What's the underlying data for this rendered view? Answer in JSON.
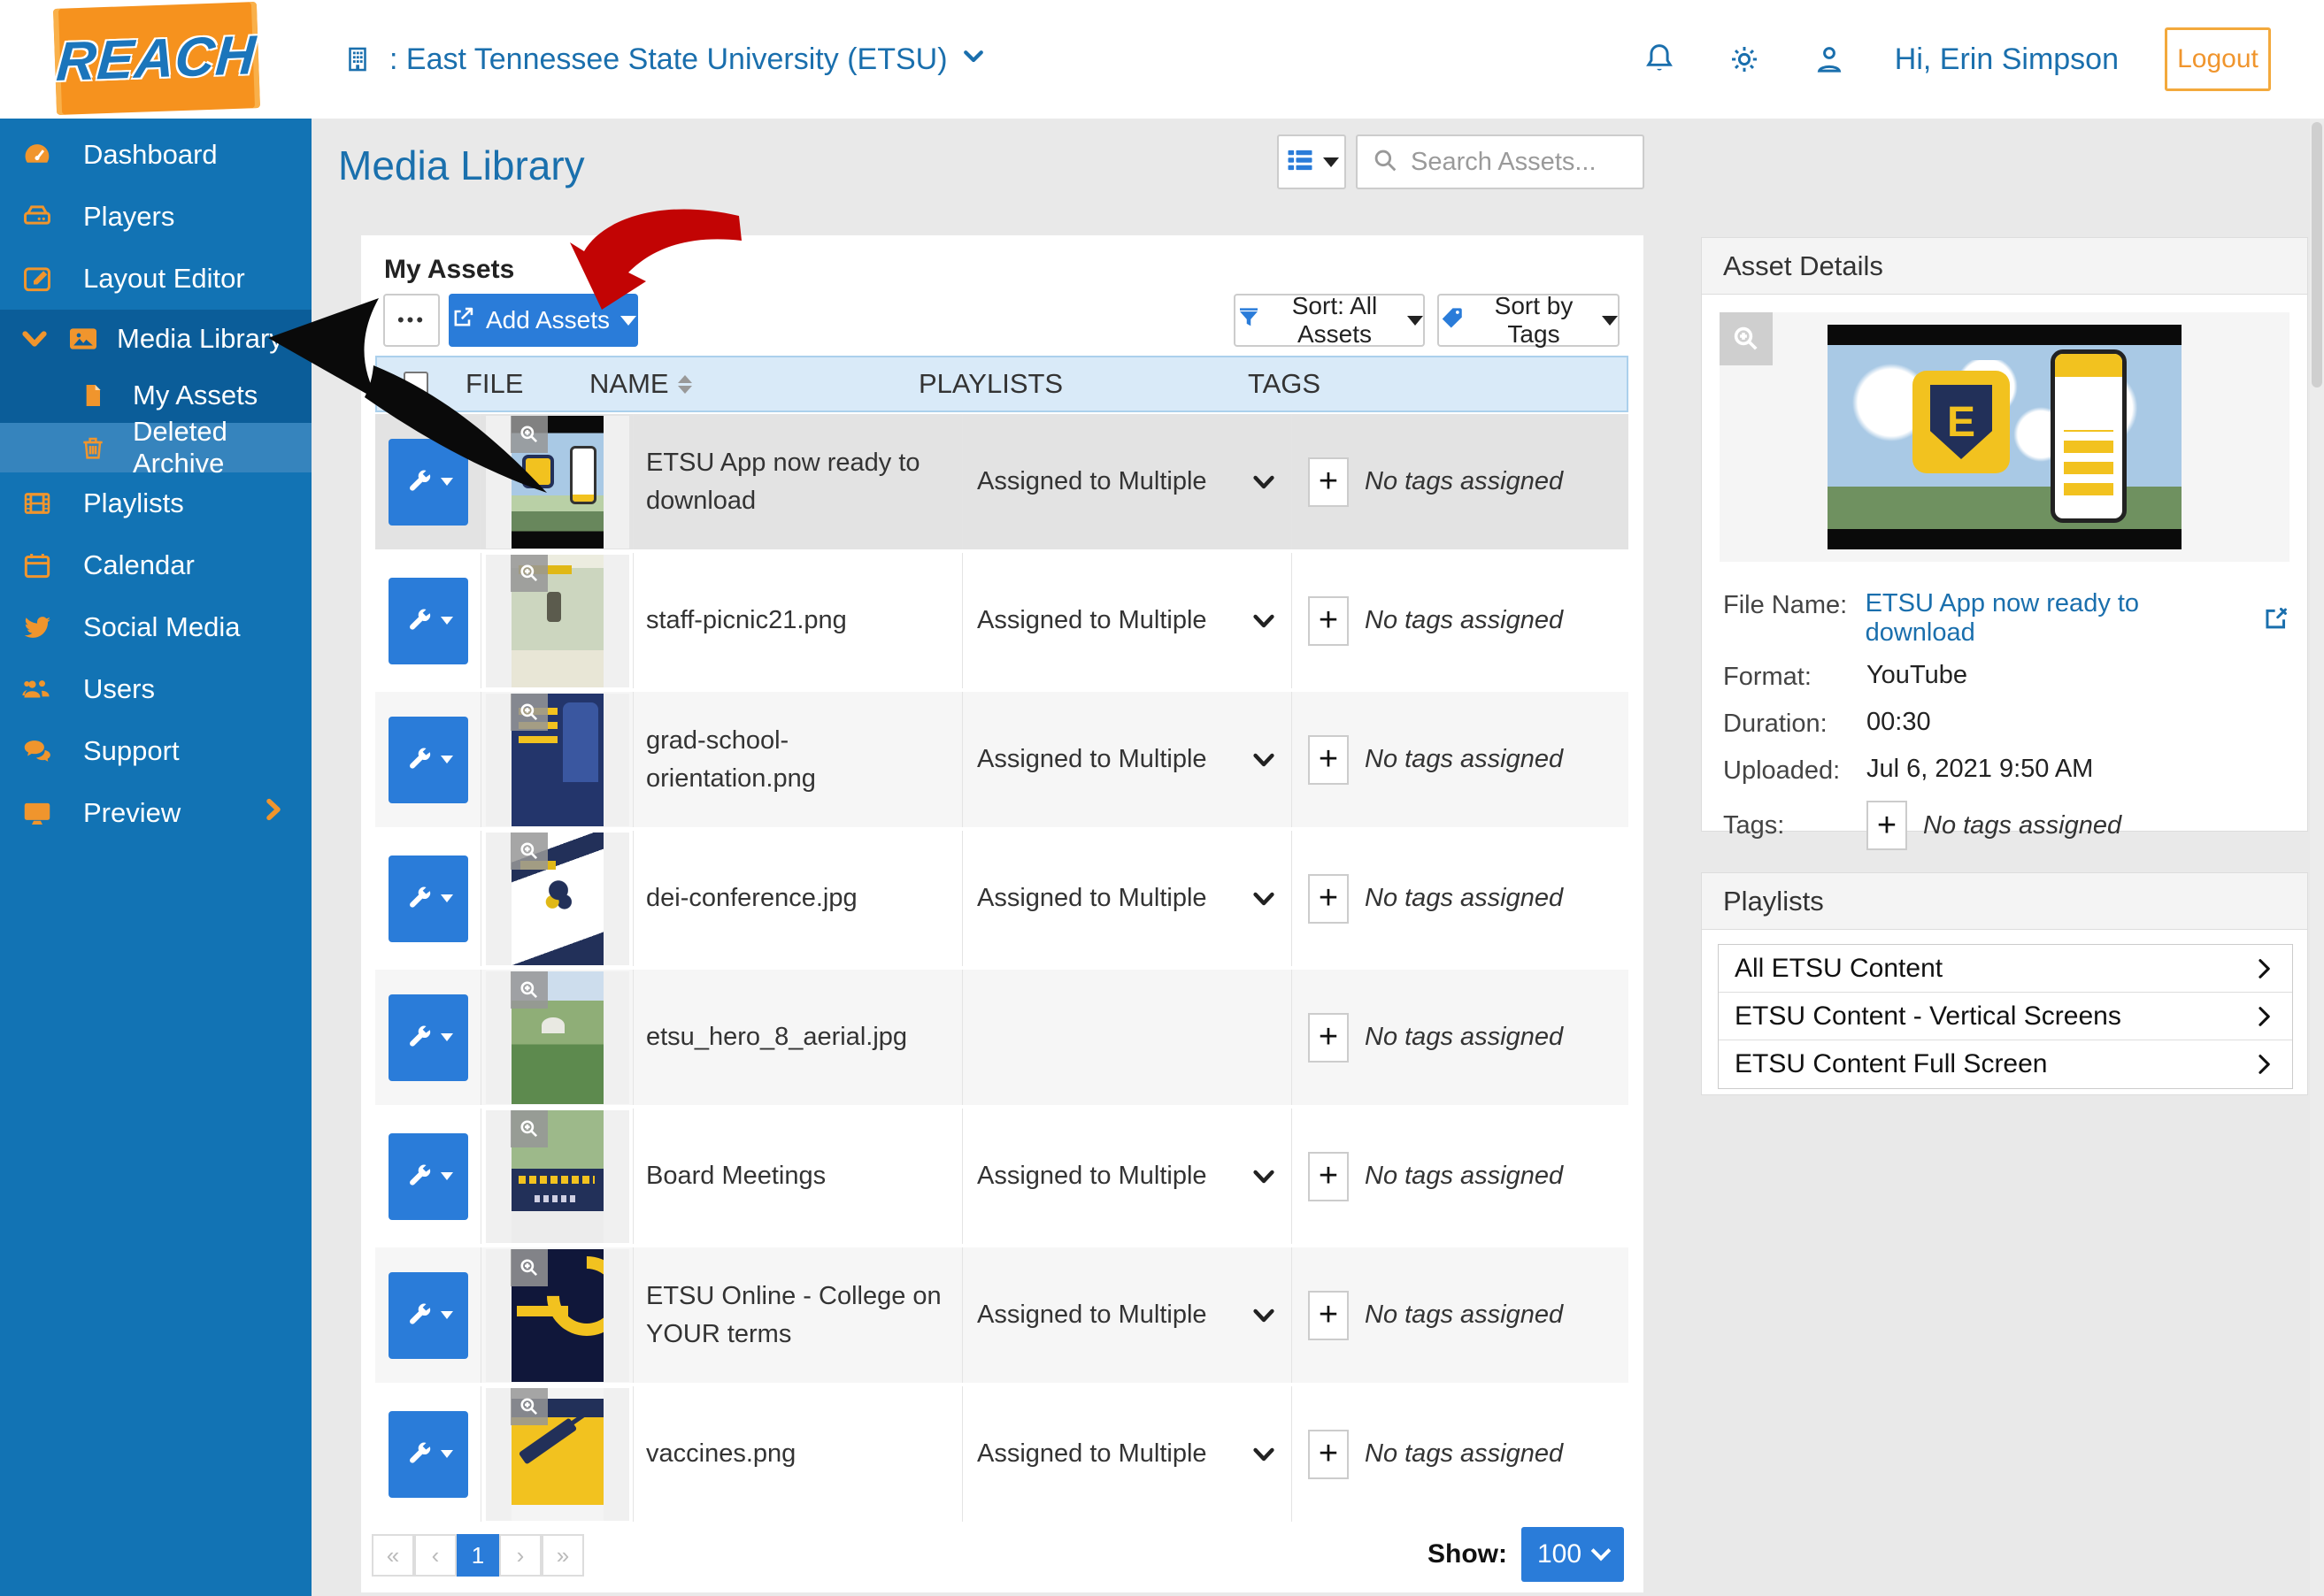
{
  "header": {
    "brand": "REACH",
    "account": ": East Tennessee State University (ETSU)",
    "greeting": "Hi, Erin Simpson",
    "logout_label": "Logout"
  },
  "sidebar": {
    "items": [
      "Dashboard",
      "Players",
      "Layout Editor",
      "Media Library",
      "My Assets",
      "Deleted Archive",
      "Playlists",
      "Calendar",
      "Social Media",
      "Users",
      "Support",
      "Preview"
    ]
  },
  "page": {
    "title": "Media Library",
    "search_placeholder": "Search Assets...",
    "section_title": "My Assets",
    "more_label": "•••",
    "add_assets_label": "Add Assets",
    "sort_assets_label": "Sort: All Assets",
    "sort_tags_label": "Sort by Tags"
  },
  "table": {
    "columns": [
      "FILE",
      "NAME",
      "PLAYLISTS",
      "TAGS"
    ],
    "rows": [
      {
        "name": "ETSU App now ready to download",
        "playlists": "Assigned to Multiple",
        "tags": "No tags assigned"
      },
      {
        "name": "staff-picnic21.png",
        "playlists": "Assigned to Multiple",
        "tags": "No tags assigned"
      },
      {
        "name": "grad-school-orientation.png",
        "playlists": "Assigned to Multiple",
        "tags": "No tags assigned"
      },
      {
        "name": "dei-conference.jpg",
        "playlists": "Assigned to Multiple",
        "tags": "No tags assigned"
      },
      {
        "name": "etsu_hero_8_aerial.jpg",
        "playlists": "",
        "tags": "No tags assigned"
      },
      {
        "name": "Board Meetings",
        "playlists": "Assigned to Multiple",
        "tags": "No tags assigned"
      },
      {
        "name": "ETSU Online - College on YOUR terms",
        "playlists": "Assigned to Multiple",
        "tags": "No tags assigned"
      },
      {
        "name": "vaccines.png",
        "playlists": "Assigned to Multiple",
        "tags": "No tags assigned"
      }
    ]
  },
  "pagination": {
    "first": "«",
    "prev": "‹",
    "page": "1",
    "next": "›",
    "last": "»",
    "show_label": "Show:",
    "page_size": "100"
  },
  "asset_details": {
    "title": "Asset Details",
    "file_name_label": "File Name:",
    "file_name": "ETSU App now ready to download",
    "format_label": "Format:",
    "format_value": "YouTube",
    "duration_label": "Duration:",
    "duration_value": "00:30",
    "uploaded_label": "Uploaded:",
    "uploaded_value": "Jul 6, 2021 9:50 AM",
    "tags_label": "Tags:",
    "tags_value": "No tags assigned"
  },
  "playlists_panel": {
    "title": "Playlists",
    "items": [
      "All ETSU Content",
      "ETSU Content - Vertical Screens",
      "ETSU Content Full Screen"
    ]
  },
  "colors": {
    "sidebar_blue": "#1273b4",
    "sidebar_dark_blue": "#0b5d99",
    "accent_orange": "#f0952d",
    "primary_blue": "#2a7cd9",
    "link_blue": "#1a6fad"
  }
}
